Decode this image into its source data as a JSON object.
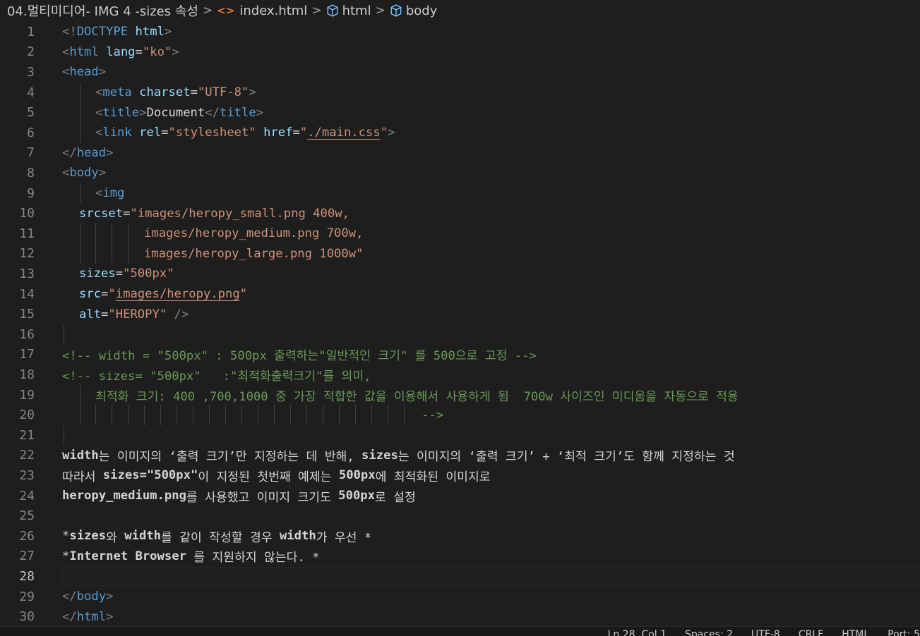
{
  "breadcrumb": {
    "folder": "04.멀티미디어",
    "subfolder": " - IMG 4 -sizes 속성",
    "file_icon": "<>",
    "file": "index.html",
    "element1": "html",
    "element2": "body",
    "separator": ">"
  },
  "editor": {
    "current_line": 28,
    "lines": [
      {
        "n": "1"
      },
      {
        "n": "2"
      },
      {
        "n": "3"
      },
      {
        "n": "4"
      },
      {
        "n": "5"
      },
      {
        "n": "6"
      },
      {
        "n": "7"
      },
      {
        "n": "8"
      },
      {
        "n": "9"
      },
      {
        "n": "10"
      },
      {
        "n": "11"
      },
      {
        "n": "12"
      },
      {
        "n": "13"
      },
      {
        "n": "14"
      },
      {
        "n": "15"
      },
      {
        "n": "16"
      },
      {
        "n": "17"
      },
      {
        "n": "18"
      },
      {
        "n": "19"
      },
      {
        "n": "20"
      },
      {
        "n": "21"
      },
      {
        "n": "22"
      },
      {
        "n": "23"
      },
      {
        "n": "24"
      },
      {
        "n": "25"
      },
      {
        "n": "26"
      },
      {
        "n": "27"
      },
      {
        "n": "28"
      },
      {
        "n": "29"
      },
      {
        "n": "30"
      }
    ],
    "code": {
      "l1": {
        "open": "<!",
        "tag": "DOCTYPE",
        "sp": " ",
        "attr": "html",
        "close": ">"
      },
      "l2": {
        "open": "<",
        "tag": "html",
        "sp": " ",
        "attr": "lang",
        "eq": "=",
        "val": "\"ko\"",
        "close": ">"
      },
      "l3": {
        "open": "<",
        "tag": "head",
        "close": ">"
      },
      "l4": {
        "open": "<",
        "tag": "meta",
        "sp": " ",
        "attr": "charset",
        "eq": "=",
        "val": "\"UTF-8\"",
        "close": ">"
      },
      "l5": {
        "open": "<",
        "tag": "title",
        "close": ">",
        "text": "Document",
        "open2": "</",
        "tag2": "title",
        "close2": ">"
      },
      "l6": {
        "open": "<",
        "tag": "link",
        "sp": " ",
        "attr": "rel",
        "eq": "=",
        "val": "\"stylesheet\"",
        "sp2": " ",
        "attr2": "href",
        "eq2": "=",
        "q1": "\"",
        "link": "./main.css",
        "q2": "\"",
        "close": ">"
      },
      "l7": {
        "open": "</",
        "tag": "head",
        "close": ">"
      },
      "l8": {
        "open": "<",
        "tag": "body",
        "close": ">"
      },
      "l9": {
        "open": "<",
        "tag": "img"
      },
      "l10": {
        "attr": "srcset",
        "eq": "=",
        "val": "\"images/heropy_small.png 400w,"
      },
      "l11": {
        "val": "images/heropy_medium.png 700w,"
      },
      "l12": {
        "val": "images/heropy_large.png 1000w\""
      },
      "l13": {
        "attr": "sizes",
        "eq": "=",
        "val": "\"500px\""
      },
      "l14": {
        "attr": "src",
        "eq": "=",
        "q1": "\"",
        "link": "images/heropy.png",
        "q2": "\""
      },
      "l15": {
        "attr": "alt",
        "eq": "=",
        "val": "\"HEROPY\"",
        "close": " />"
      },
      "l17": "<!-- width = \"500px\" : 500px 출력하는\"일반적인 크기\" 를 500으로 고정 -->",
      "l18": "<!-- sizes= \"500px\"   :\"최적화출력크기\"를 의미,",
      "l19": "최적화 크기: 400 ,700,1000 중 가장 적합한 값을 이용해서 사용하게 됨  700w 사이즈인 미디움을 자동으로 적용",
      "l20": "-->",
      "l22": {
        "a": "width",
        "b": "는 이미지의 ‘출력 크기’만 지정하는 데 반해, ",
        "c": "sizes",
        "d": "는 이미지의 ‘출력 크기’ + ‘최적 크기’도 함께 지정하는 것"
      },
      "l23": {
        "a": "따라서 ",
        "b": "sizes=\"500px\"",
        "c": "이 지정된 첫번째 예제는 ",
        "d": "500px",
        "e": "에 최적화된 이미지로"
      },
      "l24": {
        "a": "heropy_medium.png",
        "b": "를 사용했고 이미지 크기도 ",
        "c": "500px",
        "d": "로 설정"
      },
      "l26": {
        "a": "*",
        "b": "sizes",
        "c": "와 ",
        "d": "width",
        "e": "를 같이 작성할 경우 ",
        "f": "width",
        "g": "가 우선 *"
      },
      "l27": {
        "a": "*",
        "b": "Internet Browser",
        "c": " 를 지원하지 않는다. *"
      },
      "l29": {
        "open": "</",
        "tag": "body",
        "close": ">"
      },
      "l30": {
        "open": "</",
        "tag": "html",
        "close": ">"
      }
    }
  },
  "statusbar": {
    "position": "Ln 28, Col 1",
    "spaces": "Spaces: 2",
    "encoding": "UTF-8",
    "eol": "CRLF",
    "language": "HTML",
    "extra": "Port: 5"
  }
}
